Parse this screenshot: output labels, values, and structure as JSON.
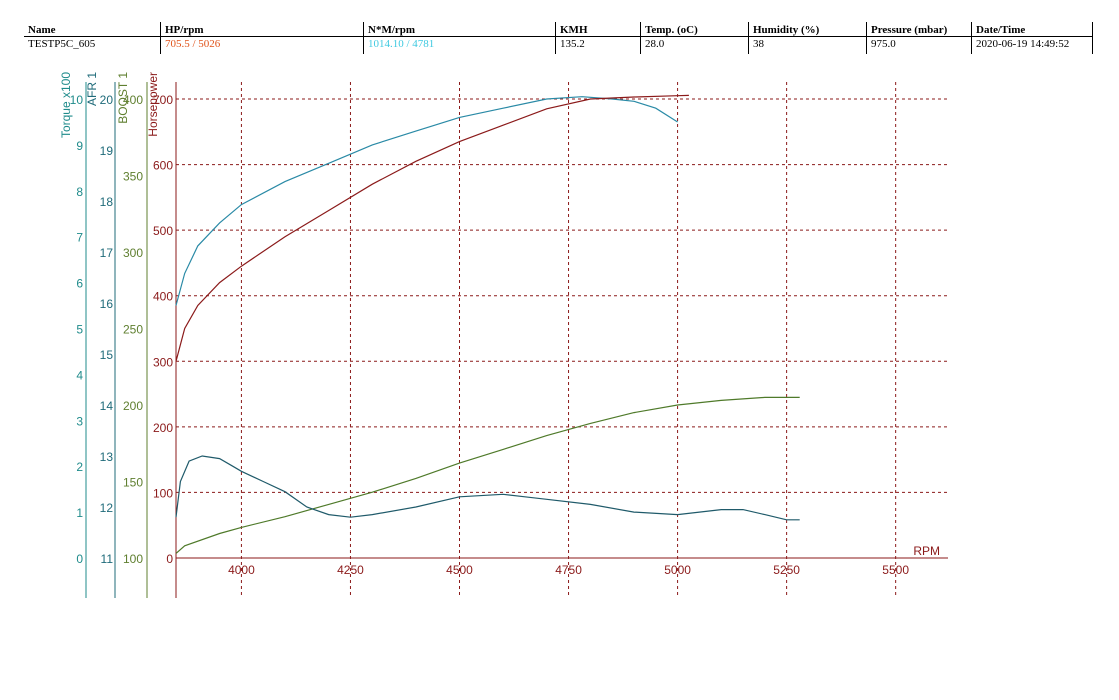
{
  "header": {
    "columns": [
      {
        "name": "Name",
        "value": "TESTP5C_605",
        "color": "#000000"
      },
      {
        "name": "HP/rpm",
        "value": "705.5 / 5026",
        "color": "#e0531a"
      },
      {
        "name": "N*M/rpm",
        "value": "1014.10 / 4781",
        "color": "#3ec9e0"
      },
      {
        "name": "KMH",
        "value": "135.2",
        "color": "#000000"
      },
      {
        "name": "Temp. (oC)",
        "value": "28.0",
        "color": "#000000"
      },
      {
        "name": "Humidity (%)",
        "value": " 38",
        "color": "#000000"
      },
      {
        "name": "Pressure (mbar)",
        "value": "975.0",
        "color": "#000000"
      },
      {
        "name": "Date/Time",
        "value": "2020-06-19 14:49:52",
        "color": "#000000"
      }
    ]
  },
  "chart_data": {
    "type": "line",
    "xlabel": "RPM",
    "xlim": [
      3850,
      5620
    ],
    "xticks": [
      "4000",
      "4250",
      "4500",
      "4750",
      "5000",
      "5250",
      "5500"
    ],
    "grid": true,
    "axes": [
      {
        "key": "torque",
        "title": "Torque x100",
        "color": "#1f8b8b",
        "ticks": [
          "0",
          "1",
          "2",
          "3",
          "4",
          "5",
          "6",
          "7",
          "8",
          "9",
          "10"
        ],
        "range": [
          0,
          10
        ]
      },
      {
        "key": "afr",
        "title": "AFR 1",
        "color": "#1f6b7a",
        "ticks": [
          "11",
          "12",
          "13",
          "14",
          "15",
          "16",
          "17",
          "18",
          "19",
          "20"
        ],
        "range": [
          11,
          20
        ]
      },
      {
        "key": "boost",
        "title": "BOOST 1",
        "color": "#5f7f2f",
        "ticks": [
          "100",
          "150",
          "200",
          "250",
          "300",
          "350",
          "400"
        ],
        "range": [
          100,
          400
        ]
      },
      {
        "key": "hp",
        "title": "Horsepower",
        "color": "#8b1a1a",
        "ticks": [
          "0",
          "100",
          "200",
          "300",
          "400",
          "500",
          "600",
          "700"
        ],
        "range": [
          0,
          700
        ]
      }
    ],
    "series": [
      {
        "key": "torque",
        "axis": "torque",
        "color": "#2a8aa6",
        "x": [
          3850,
          3870,
          3900,
          3950,
          4000,
          4100,
          4200,
          4300,
          4400,
          4500,
          4600,
          4700,
          4781,
          4850,
          4900,
          4950,
          5000
        ],
        "y": [
          5.5,
          6.2,
          6.8,
          7.3,
          7.7,
          8.2,
          8.6,
          9.0,
          9.3,
          9.6,
          9.8,
          10.0,
          10.05,
          10.0,
          9.95,
          9.8,
          9.5
        ]
      },
      {
        "key": "hp",
        "axis": "hp",
        "color": "#8b1a1a",
        "x": [
          3850,
          3870,
          3900,
          3950,
          4000,
          4100,
          4200,
          4300,
          4400,
          4500,
          4600,
          4700,
          4800,
          4900,
          5000,
          5026
        ],
        "y": [
          300,
          350,
          385,
          420,
          445,
          490,
          530,
          570,
          605,
          635,
          660,
          685,
          700,
          703,
          705,
          705.5
        ]
      },
      {
        "key": "boost",
        "axis": "boost",
        "color": "#4f7a2a",
        "x": [
          3850,
          3870,
          3950,
          4000,
          4100,
          4200,
          4300,
          4400,
          4500,
          4600,
          4700,
          4800,
          4900,
          5000,
          5100,
          5200,
          5280
        ],
        "y": [
          103,
          108,
          116,
          120,
          127,
          135,
          143,
          152,
          162,
          171,
          180,
          188,
          195,
          200,
          203,
          205,
          205
        ]
      },
      {
        "key": "afr",
        "axis": "afr",
        "color": "#1f5a6a",
        "x": [
          3850,
          3860,
          3880,
          3910,
          3950,
          3980,
          4000,
          4050,
          4100,
          4150,
          4200,
          4250,
          4300,
          4400,
          4500,
          4600,
          4650,
          4700,
          4800,
          4900,
          5000,
          5050,
          5100,
          5150,
          5200,
          5250,
          5280
        ],
        "y": [
          11.8,
          12.5,
          12.9,
          13.0,
          12.95,
          12.8,
          12.7,
          12.5,
          12.3,
          12.0,
          11.85,
          11.8,
          11.85,
          12.0,
          12.2,
          12.25,
          12.2,
          12.15,
          12.05,
          11.9,
          11.85,
          11.9,
          11.95,
          11.95,
          11.85,
          11.75,
          11.75
        ]
      }
    ]
  }
}
